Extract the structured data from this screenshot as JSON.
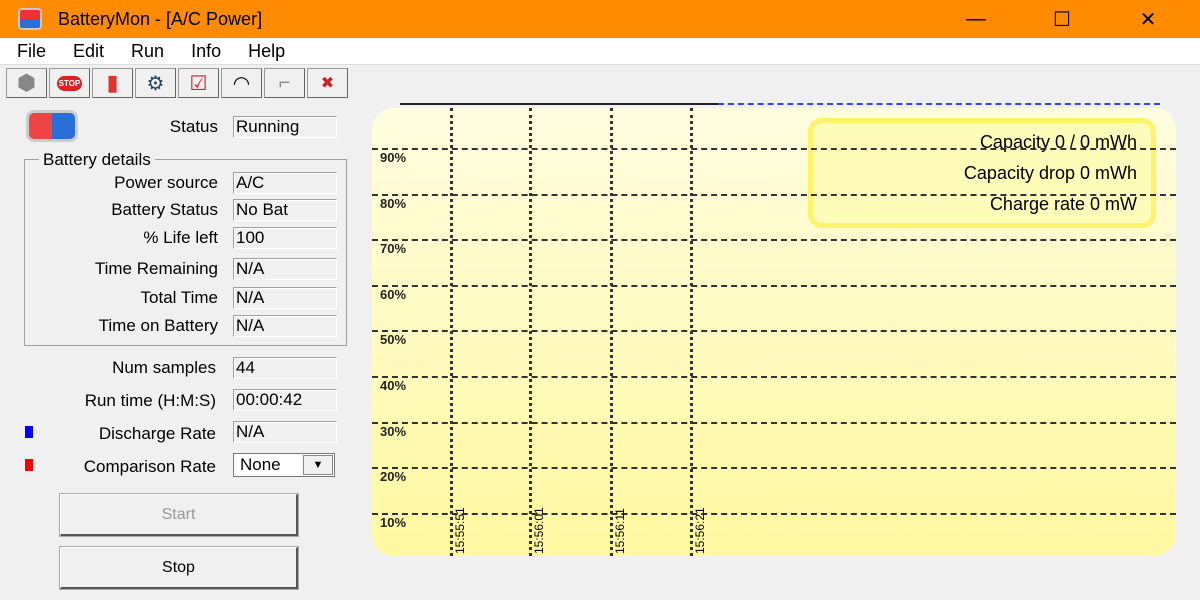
{
  "window": {
    "title": "BatteryMon - [A/C Power]",
    "minimize": "—",
    "maximize": "☐",
    "close": "✕"
  },
  "menu": [
    "File",
    "Edit",
    "Run",
    "Info",
    "Help"
  ],
  "toolbar": [
    {
      "icon": "circle-icon",
      "glyph": "⬢"
    },
    {
      "icon": "stop-icon",
      "glyph": "STOP"
    },
    {
      "icon": "battery-icon",
      "glyph": "▮"
    },
    {
      "icon": "settings-info-icon",
      "glyph": "⚙"
    },
    {
      "icon": "checklist-icon",
      "glyph": "☑"
    },
    {
      "icon": "gauge-icon",
      "glyph": "◠"
    },
    {
      "icon": "plug-icon",
      "glyph": "⌐"
    },
    {
      "icon": "tools-icon",
      "glyph": "✖"
    }
  ],
  "status": {
    "label": "Status",
    "value": "Running"
  },
  "battery_details": {
    "title": "Battery details",
    "rows": [
      {
        "label": "Power source",
        "value": "A/C"
      },
      {
        "label": "Battery Status",
        "value": "No Bat"
      },
      {
        "label": "% Life left",
        "value": "100"
      },
      {
        "label": "Time Remaining",
        "value": "N/A"
      },
      {
        "label": "Total Time",
        "value": "N/A"
      },
      {
        "label": "Time on Battery",
        "value": "N/A"
      }
    ]
  },
  "num_samples": {
    "label": "Num samples",
    "value": "44"
  },
  "run_time": {
    "label": "Run time (H:M:S)",
    "value": "00:00:42"
  },
  "discharge_rate": {
    "label": "Discharge Rate",
    "value": "N/A",
    "color": "#0000ff"
  },
  "comparison_rate": {
    "label": "Comparison Rate",
    "value": "None",
    "color": "#ff0000"
  },
  "buttons": {
    "start": "Start",
    "stop": "Stop"
  },
  "chart_data": {
    "type": "line",
    "y_ticks": [
      "90%",
      "80%",
      "70%",
      "60%",
      "50%",
      "40%",
      "30%",
      "20%",
      "10%"
    ],
    "x_ticks": [
      "15:55:51",
      "15:56:01",
      "15:56:11",
      "15:56:21"
    ],
    "info": [
      "Capacity 0 / 0 mWh",
      "Capacity drop 0 mWh",
      "Charge rate 0 mW"
    ]
  }
}
